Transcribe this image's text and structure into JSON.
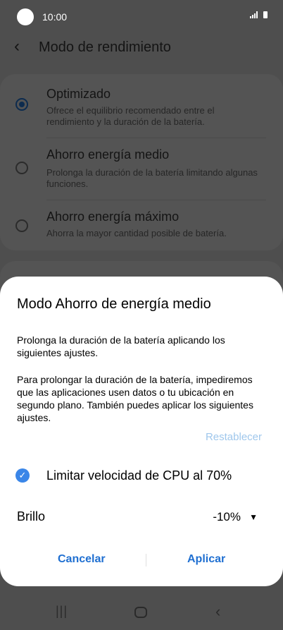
{
  "status_bar": {
    "time": "10:00"
  },
  "header": {
    "title": "Modo de rendimiento"
  },
  "options": [
    {
      "title": "Optimizado",
      "desc": "Ofrece el equilibrio recomendado entre el rendimiento y la duración de la batería.",
      "selected": true
    },
    {
      "title": "Ahorro energía medio",
      "desc": "Prolonga la duración de la batería limitando algunas funciones.",
      "selected": false
    },
    {
      "title": "Ahorro energía máximo",
      "desc": "Ahorra la mayor cantidad posible de batería.",
      "selected": false
    }
  ],
  "dialog": {
    "title": "Modo Ahorro de energía medio",
    "paragraph1": "Prolonga la duración de la batería aplicando los siguientes ajustes.",
    "paragraph2": "Para prolongar la duración de la batería, impediremos que las aplicaciones usen datos o tu ubicación en segundo plano. También puedes aplicar los siguientes ajustes.",
    "reset_label": "Restablecer",
    "cpu_limit_label": "Limitar velocidad de CPU al 70%",
    "cpu_limit_checked": true,
    "brightness_label": "Brillo",
    "brightness_value": "-10%",
    "cancel_label": "Cancelar",
    "apply_label": "Aplicar"
  },
  "colors": {
    "accent": "#3a86e8",
    "button_text": "#1f6fd1",
    "reset_text": "#9fc7ec"
  },
  "icons": {
    "back": "chevron-left-icon",
    "check": "check-circle-icon",
    "dropdown": "triangle-down-icon",
    "nav_recent": "recent-apps-icon",
    "nav_home": "home-icon",
    "nav_back": "back-icon"
  }
}
